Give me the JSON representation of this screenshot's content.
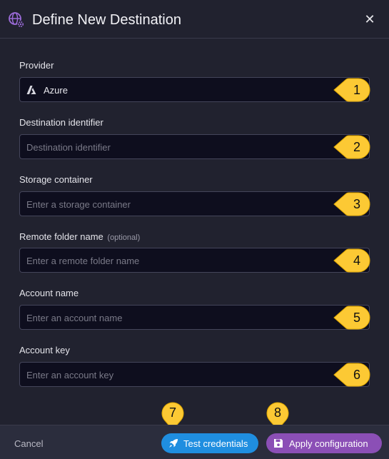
{
  "header": {
    "title": "Define New Destination",
    "icon": "globe-gear-icon",
    "close_label": "✕"
  },
  "fields": {
    "provider": {
      "label": "Provider",
      "value": "Azure",
      "icon": "azure-icon"
    },
    "destination_identifier": {
      "label": "Destination identifier",
      "placeholder": "Destination identifier"
    },
    "storage_container": {
      "label": "Storage container",
      "placeholder": "Enter a storage container"
    },
    "remote_folder_name": {
      "label": "Remote folder name",
      "optional": "(optional)",
      "placeholder": "Enter a remote folder name"
    },
    "account_name": {
      "label": "Account name",
      "placeholder": "Enter an account name"
    },
    "account_key": {
      "label": "Account key",
      "placeholder": "Enter an account key"
    }
  },
  "callouts": [
    "1",
    "2",
    "3",
    "4",
    "5",
    "6",
    "7",
    "8"
  ],
  "footer": {
    "cancel_label": "Cancel",
    "test_label": "Test credentials",
    "apply_label": "Apply configuration"
  },
  "colors": {
    "background": "#21222f",
    "input_bg": "#0e0e1e",
    "test_button": "#1f8ee0",
    "apply_button": "#8b4fb6",
    "callout": "#fcc934",
    "brand_icon": "#9b6bd8"
  }
}
